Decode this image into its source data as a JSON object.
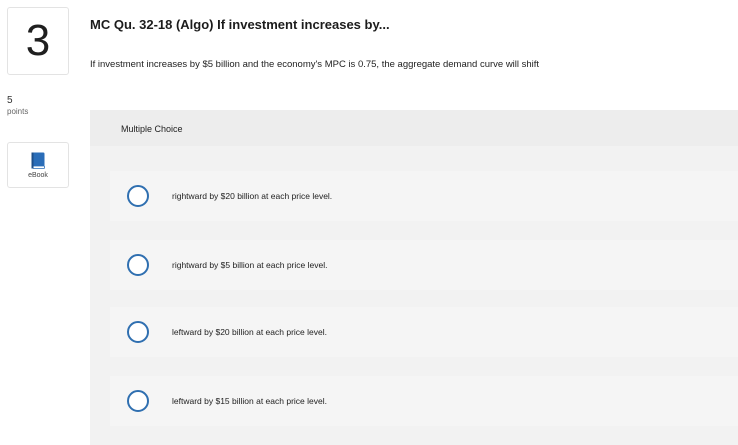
{
  "question": {
    "number": "3",
    "points_value": "5",
    "points_label": "points",
    "ebook_label": "eBook",
    "title": "MC Qu. 32-18 (Algo) If investment increases by...",
    "prompt": "If investment increases by $5 billion and the economy's MPC is 0.75, the aggregate demand curve will shift"
  },
  "choices": {
    "header": "Multiple Choice",
    "options": [
      {
        "label": "rightward by $20 billion at each price level."
      },
      {
        "label": "rightward by $5 billion at each price level."
      },
      {
        "label": "leftward by $20 billion at each price level."
      },
      {
        "label": "leftward by $15 billion at each price level."
      }
    ]
  },
  "colors": {
    "radio_border": "#2f6fb0",
    "ebook_icon": "#2a6db8",
    "panel_bg": "#f2f2f2"
  },
  "icons": {
    "ebook": "book-icon"
  }
}
